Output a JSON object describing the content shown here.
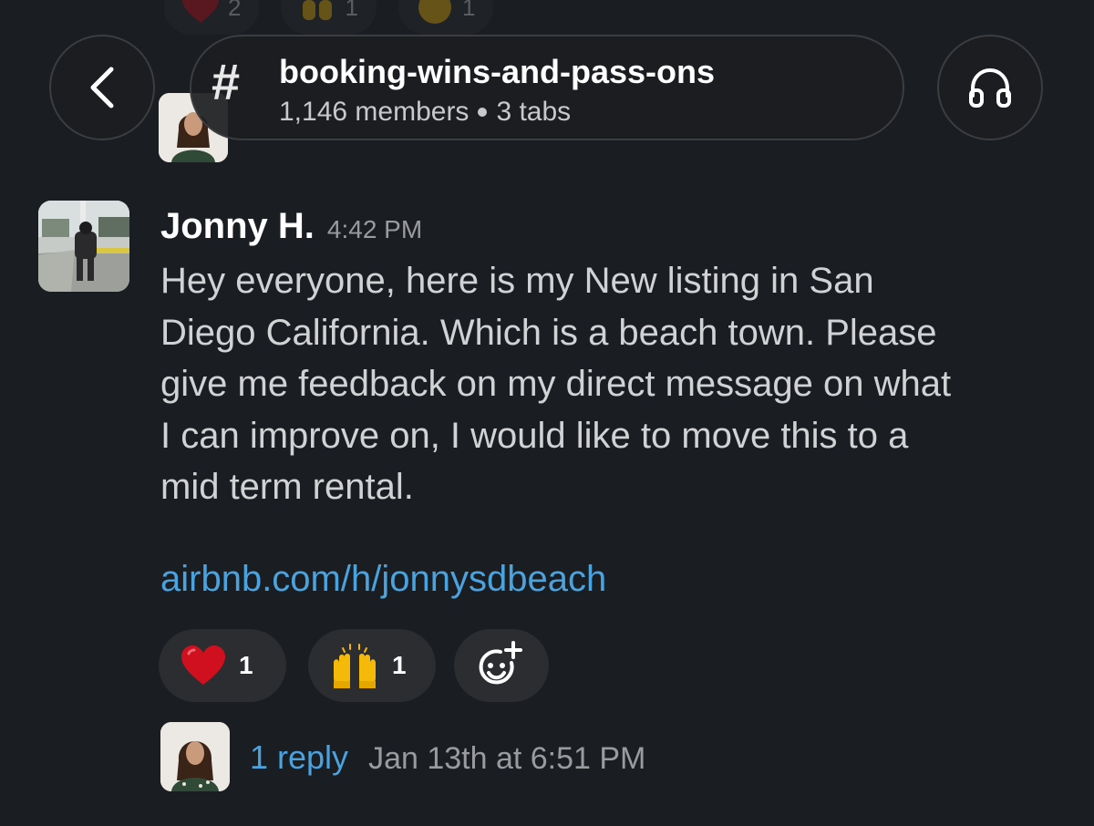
{
  "header": {
    "channel_name": "booking-wins-and-pass-ons",
    "members": "1,146 members",
    "tabs": "3 tabs"
  },
  "previous_reactions": [
    {
      "count": "2"
    },
    {
      "count": "1"
    },
    {
      "count": "1"
    }
  ],
  "message": {
    "sender": "Jonny H.",
    "time": "4:42 PM",
    "body_lines": [
      "Hey everyone, here is my New listing in San",
      "Diego California. Which is a beach town. Please",
      "give me feedback on my direct message on what",
      "I can improve on, I would like to move this to a",
      "mid term rental."
    ],
    "link": "airbnb.com/h/jonnysdbeach"
  },
  "reactions": [
    {
      "emoji": "heart-icon",
      "count": "1"
    },
    {
      "emoji": "raising-hands-icon",
      "count": "1"
    }
  ],
  "thread": {
    "reply_count": "1 reply",
    "last_reply": "Jan 13th at 6:51 PM"
  },
  "colors": {
    "background": "#1a1d21",
    "link": "#4aa3df",
    "pill": "#2b2d31"
  }
}
